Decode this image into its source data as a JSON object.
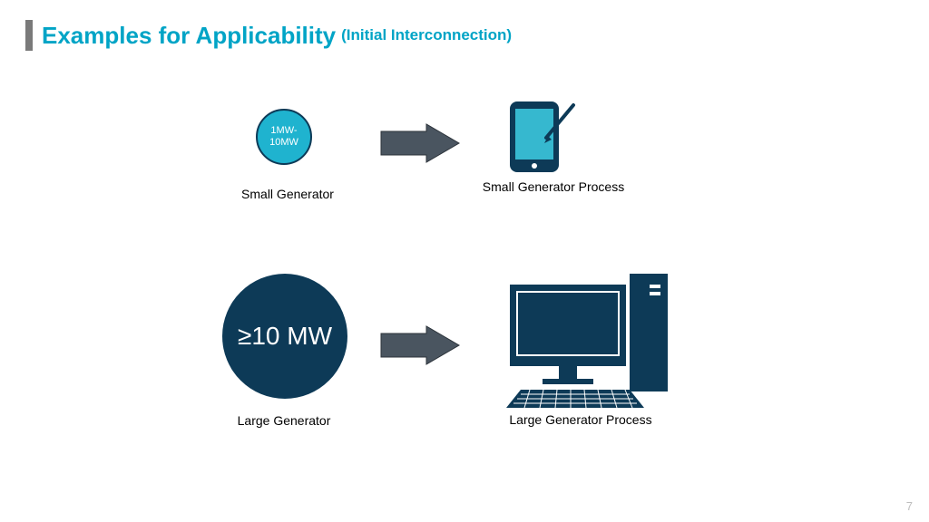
{
  "title": {
    "main": "Examples for Applicability",
    "sub": "(Initial Interconnection)"
  },
  "row1": {
    "circle_text": "1MW-10MW",
    "generator_label": "Small Generator",
    "process_label": "Small Generator Process"
  },
  "row2": {
    "circle_text": "≥10 MW",
    "generator_label": "Large Generator",
    "process_label": "Large Generator Process"
  },
  "page_number": "7",
  "colors": {
    "accent_teal": "#00a4c6",
    "circle_light": "#1fb3cf",
    "dark_navy": "#0d3a57",
    "arrow_fill": "#4a5560"
  }
}
